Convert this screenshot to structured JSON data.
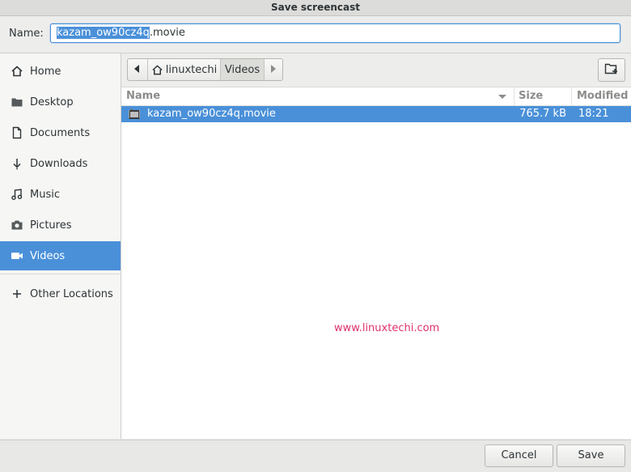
{
  "window": {
    "title": "Save screencast"
  },
  "name_field": {
    "label": "Name:",
    "selected_part": "kazam_ow90cz4q",
    "rest": ".movie"
  },
  "sidebar": {
    "items": [
      {
        "label": "Home",
        "icon": "home-icon"
      },
      {
        "label": "Desktop",
        "icon": "folder-icon"
      },
      {
        "label": "Documents",
        "icon": "document-icon"
      },
      {
        "label": "Downloads",
        "icon": "download-icon"
      },
      {
        "label": "Music",
        "icon": "music-icon"
      },
      {
        "label": "Pictures",
        "icon": "camera-icon"
      },
      {
        "label": "Videos",
        "icon": "video-icon",
        "active": true
      }
    ],
    "other": {
      "label": "Other Locations",
      "icon": "plus-icon"
    }
  },
  "pathbar": {
    "crumbs": [
      "linuxtechi",
      "Videos"
    ],
    "active": "Videos"
  },
  "columns": {
    "name": "Name",
    "size": "Size",
    "modified": "Modified"
  },
  "files": [
    {
      "name": "kazam_ow90cz4q.movie",
      "size": "765.7 kB",
      "modified": "18:21",
      "selected": true
    }
  ],
  "watermark": "www.linuxtechi.com",
  "buttons": {
    "cancel": "Cancel",
    "save": "Save"
  },
  "colors": {
    "accent": "#4a90d9",
    "watermark": "#e0306a"
  }
}
